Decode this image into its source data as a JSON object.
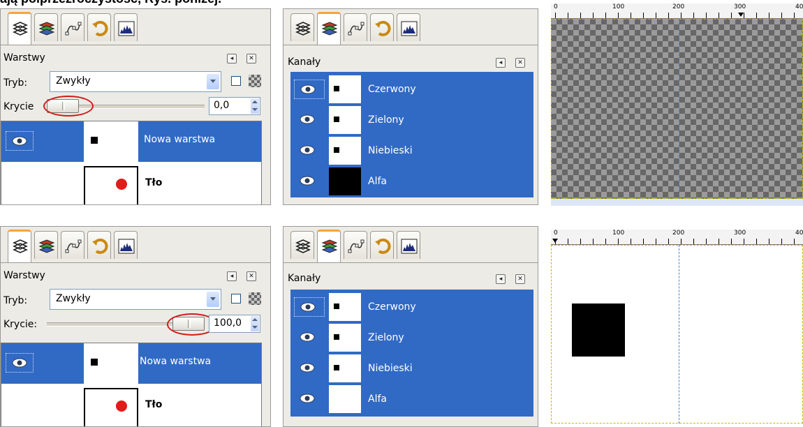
{
  "heading": "ają półprzezroczystość, Rys. poniżej.",
  "icons": {
    "tabs": [
      "layers-icon",
      "channels-icon",
      "paths-icon",
      "undo-history-icon",
      "histogram-icon"
    ]
  },
  "top": {
    "layers": {
      "title": "Warstwy",
      "mode_label": "Tryb:",
      "mode_value": "Zwykły",
      "opacity_label": "Krycie",
      "opacity_value": "0,0",
      "opacity_percent": 0,
      "layers": [
        {
          "name": "Nowa warstwa",
          "selected": true
        },
        {
          "name": "Tło",
          "selected": false
        }
      ]
    },
    "channels": {
      "title": "Kanały",
      "items": [
        "Czerwony",
        "Zielony",
        "Niebieski",
        "Alfa"
      ],
      "alpha_thumb_color": "#000000"
    }
  },
  "bottom": {
    "layers": {
      "title": "Warstwy",
      "mode_label": "Tryb:",
      "mode_value": "Zwykły",
      "opacity_label": "Krycie:",
      "opacity_value": "100,0",
      "opacity_percent": 100,
      "layers": [
        {
          "name": "Nowa warstwa",
          "selected": true
        },
        {
          "name": "Tło",
          "selected": false
        }
      ]
    },
    "channels": {
      "title": "Kanały",
      "items": [
        "Czerwony",
        "Zielony",
        "Niebieski",
        "Alfa"
      ],
      "alpha_thumb_color": "#ffffff"
    }
  },
  "ruler": {
    "labels": [
      "0",
      "100",
      "200",
      "300",
      "40"
    ]
  },
  "colors": {
    "selection": "#316ac5",
    "highlight_ring": "#d21b1b",
    "tab_accent": "#f7a33b"
  }
}
